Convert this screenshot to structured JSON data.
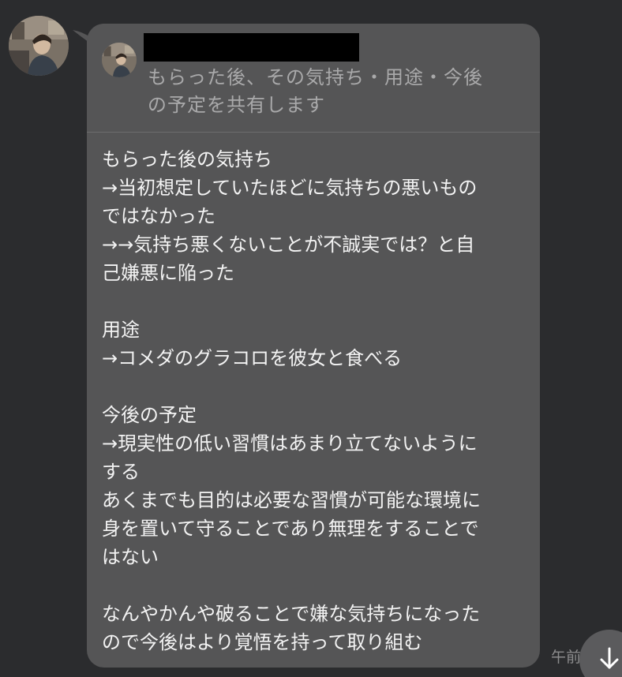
{
  "quote": {
    "text": "もらった後、その気持ち・用途・今後\nの予定を共有します"
  },
  "message": {
    "body": "もらった後の気持ち\n→当初想定していたほどに気持ちの悪いもの\nではなかった\n→→気持ち悪くないことが不誠実では？と自\n己嫌悪に陥った\n\n用途\n→コメダのグラコロを彼女と食べる\n\n今後の予定\n→現実性の低い習慣はあまり立てないように\nする\nあくまでも目的は必要な習慣が可能な環境に\n身を置いて守ることであり無理をすることで\nはない\n\nなんやかんや破ることで嫌な気持ちになった\nので今後はより覚悟を持って取り組む"
  },
  "timestamp": "午前",
  "icons": {
    "scroll": "arrow-down-icon"
  },
  "colors": {
    "background": "#2b2c2e",
    "bubble": "#555556",
    "text": "#f3f3f3",
    "quote_text": "#a9a9aa",
    "redaction": "#000000"
  }
}
